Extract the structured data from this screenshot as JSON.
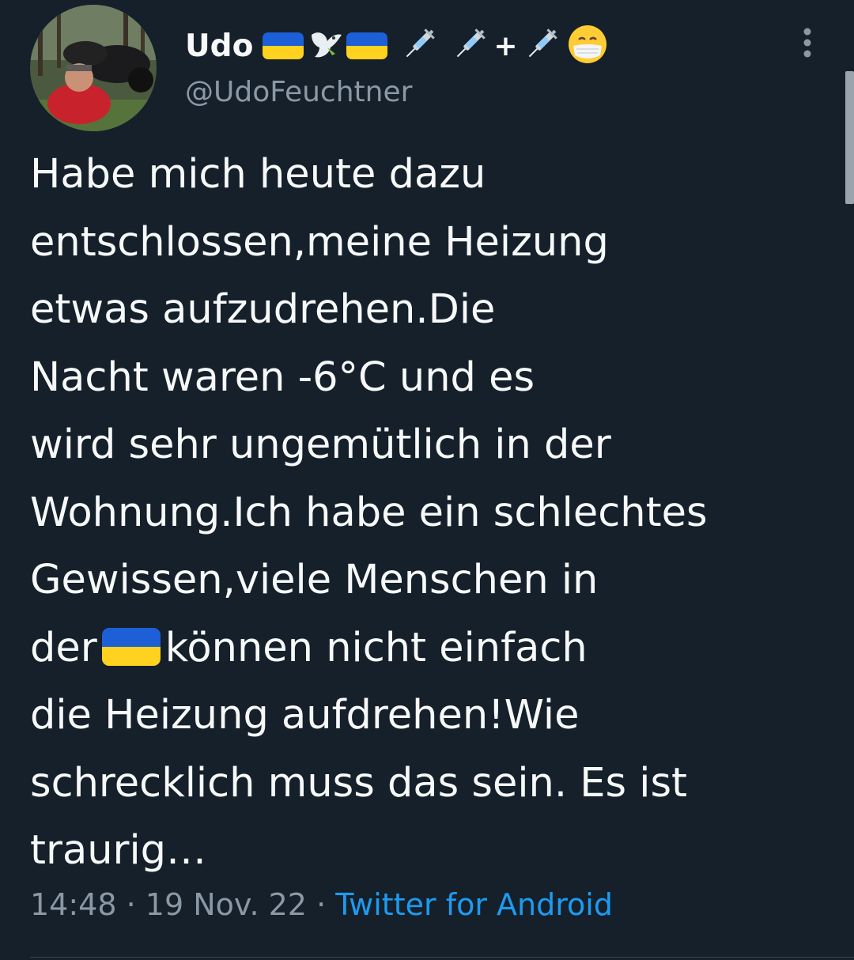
{
  "author": {
    "display_name": "Udo",
    "handle": "@UdoFeuchtner",
    "name_emoji": [
      "ukraine-flag",
      "dove",
      "ukraine-flag",
      "syringe",
      "syringe",
      "plus",
      "syringe",
      "face-with-medical-mask"
    ],
    "plus_text": "+"
  },
  "tweet": {
    "text_before_flag": "Habe mich heute dazu\nentschlossen,meine Heizung\netwas aufzudrehen.Die\nNacht waren -6°C und es\nwird sehr ungemütlich in der\nWohnung.Ich habe ein schlechtes\nGewissen,viele Menschen in\nder",
    "text_after_flag": "können nicht einfach\ndie Heizung aufdrehen!Wie\nschrecklich muss das sein. Es ist\ntraurig…",
    "inline_emoji": "ukraine-flag"
  },
  "meta": {
    "time": "14:48",
    "separator": "·",
    "date": "19 Nov. 22",
    "source": "Twitter for Android"
  },
  "colors": {
    "background": "#15202b",
    "text": "#f7f9f9",
    "secondary": "#8b98a5",
    "link": "#1d9bf0",
    "flag_blue": "#1d5fd6",
    "flag_yellow": "#ffd21f"
  }
}
